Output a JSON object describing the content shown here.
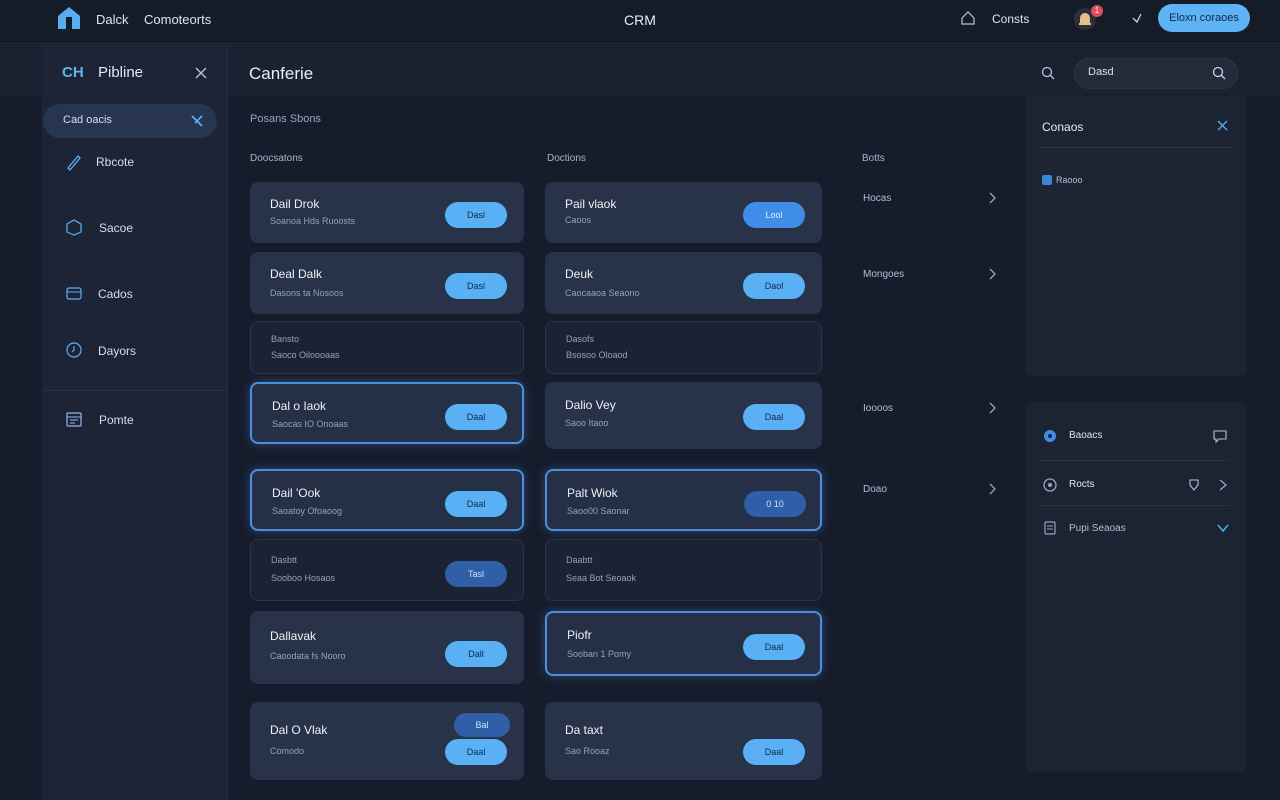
{
  "topbar": {
    "nav": [
      "Dalck",
      "Comoteorts"
    ],
    "title": "CRM",
    "bell_label": "Consts",
    "notification_count": "1",
    "cta_label": "Eloxn coraoes"
  },
  "sidebar": {
    "brand": "CH",
    "title": "Pibline",
    "active_item": "Cad oacis",
    "items": [
      {
        "label": "Rbcote",
        "icon": "pen-icon"
      },
      {
        "label": "Sacoe",
        "icon": "box-icon"
      },
      {
        "label": "Cados",
        "icon": "folder-icon"
      },
      {
        "label": "Dayors",
        "icon": "clock-icon"
      },
      {
        "label": "Pomte",
        "icon": "calendar-icon"
      }
    ]
  },
  "main": {
    "title": "Canferie",
    "breadcrumb": "Posans  Sbons",
    "column_heads": [
      "Doocsatons",
      "Doctions",
      "Botts"
    ],
    "left_cards": [
      {
        "title": "Dail Drok",
        "sub": "Soanoa Hds Ruoosts",
        "button": "Dasl"
      },
      {
        "title": "Deal Dalk",
        "sub": "Dasons ta Nosoos",
        "button": "Dasl"
      },
      {
        "title": "Bansto",
        "sub": "Saoco Oiloooaas",
        "button": ""
      },
      {
        "title": "Dal o Iaok",
        "sub": "Saocas IO Onoaas",
        "button": "Daal"
      },
      {
        "title": "Dail 'Ook",
        "sub": "Saoatoy Ofoaoog",
        "button": "Daal"
      },
      {
        "title": "Dasbtt",
        "sub": "Sooboo Hosaos",
        "button": "Tasl"
      },
      {
        "title": "Dallavak",
        "sub": "Caoodata fs Nooro",
        "button": "Dall"
      },
      {
        "title": "Dal O Vlak",
        "sub": "Comodo",
        "button": "Daal",
        "extra_button": "Bal"
      }
    ],
    "mid_cards": [
      {
        "title": "Pail vlaok",
        "sub": "Caoos",
        "button": "Lool"
      },
      {
        "title": "Deuk",
        "sub": "Caocaaoa Seaono",
        "button": "Daol"
      },
      {
        "title": "Dasofs",
        "sub": "Bsosoo Oloaod",
        "button": ""
      },
      {
        "title": "Dalio Vey",
        "sub": "Saoo Itaoo",
        "button": "Daal"
      },
      {
        "title": "Palt Wiok",
        "sub": "Saoo00 Saonar",
        "button": "0 10"
      },
      {
        "title": "Daabtt",
        "sub": "Seaa Bot Seoaok",
        "button": ""
      },
      {
        "title": "Piofr",
        "sub": "Sooban 1 Pomy",
        "button": "Daal"
      },
      {
        "title": "Da taxt",
        "sub": "Sao Rooaz",
        "button": "Daal"
      }
    ],
    "right_list": [
      "Hocas",
      "Mongoes",
      "Ioooos",
      "Doao"
    ]
  },
  "right": {
    "search_value": "Dasd",
    "panel1_title": "Conaos",
    "panel1_item": "Raooo",
    "panel2_items": [
      "Baoacs",
      "Rocts",
      "Pupi Seaoas"
    ]
  },
  "colors": {
    "accent": "#5ab0f4",
    "highlight": "#4b8fe0",
    "background": "#161c2b"
  }
}
